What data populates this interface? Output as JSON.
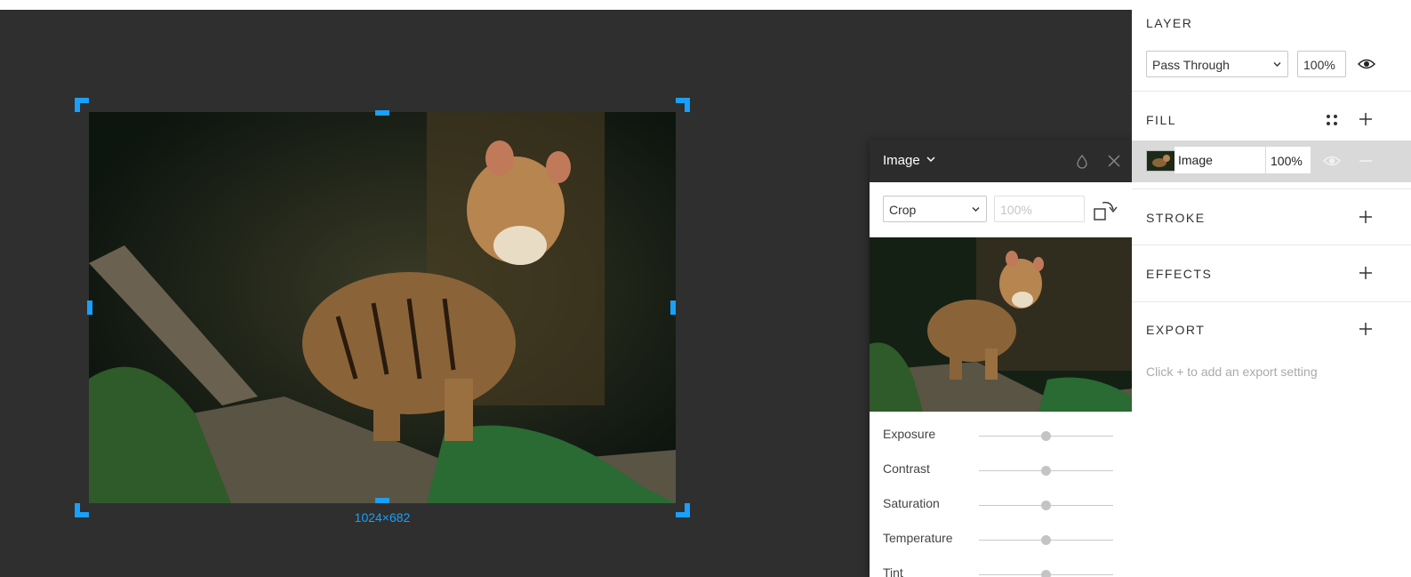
{
  "canvas": {
    "dimensions_label": "1024×682"
  },
  "image_panel": {
    "title": "Image",
    "scale_mode": "Crop",
    "scale_value_placeholder": "100%",
    "adjustments": [
      {
        "label": "Exposure",
        "value": 0
      },
      {
        "label": "Contrast",
        "value": 0
      },
      {
        "label": "Saturation",
        "value": 0
      },
      {
        "label": "Temperature",
        "value": 0
      },
      {
        "label": "Tint",
        "value": 0
      }
    ]
  },
  "layer": {
    "title": "LAYER",
    "blend_mode": "Pass Through",
    "opacity": "100%"
  },
  "fill": {
    "title": "FILL",
    "items": [
      {
        "type": "Image",
        "opacity": "100%"
      }
    ]
  },
  "stroke": {
    "title": "STROKE"
  },
  "effects": {
    "title": "EFFECTS"
  },
  "export": {
    "title": "EXPORT",
    "hint": "Click + to add an export setting"
  },
  "colors": {
    "accent": "#18a0fb",
    "canvas_bg": "#2f2f2f",
    "panel_header": "#2c2c2c",
    "selected_row": "#d9d9d9"
  },
  "icons": [
    "chevron-down-icon",
    "drop-icon",
    "close-icon",
    "rotate-icon",
    "eye-icon",
    "style-grid-icon",
    "plus-icon",
    "minus-icon"
  ]
}
